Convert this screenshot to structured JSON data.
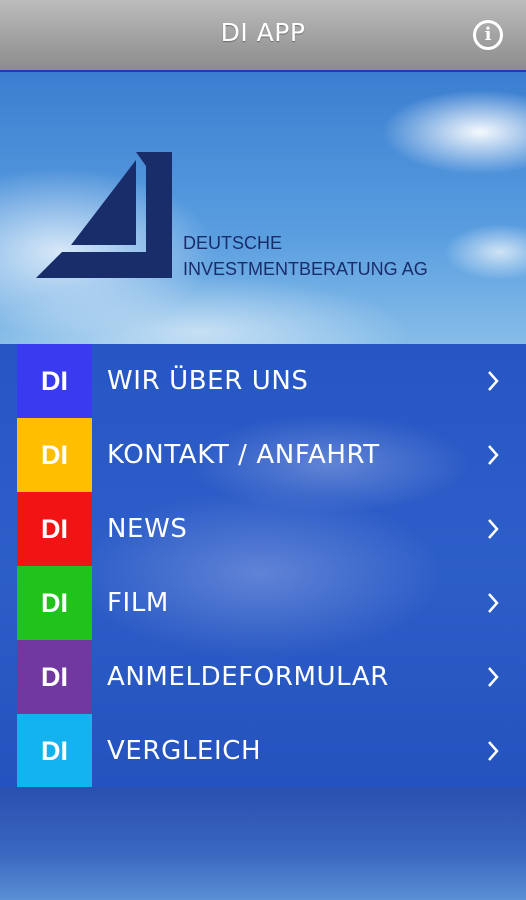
{
  "header": {
    "title": "DI APP",
    "info_icon": "info-circle-icon"
  },
  "logo": {
    "line1": "DEUTSCHE",
    "line2": "INVESTMENTBERATUNG AG",
    "color": "#1a2d6b"
  },
  "menu": {
    "items": [
      {
        "badge": "DI",
        "label": "WIR ÜBER UNS",
        "color": "#3a3af0"
      },
      {
        "badge": "DI",
        "label": "KONTAKT / ANFAHRT",
        "color": "#ffbf00"
      },
      {
        "badge": "DI",
        "label": "NEWS",
        "color": "#f21414"
      },
      {
        "badge": "DI",
        "label": "FILM",
        "color": "#22c21d"
      },
      {
        "badge": "DI",
        "label": "ANMELDEFORMULAR",
        "color": "#7038a0"
      },
      {
        "badge": "DI",
        "label": "VERGLEICH",
        "color": "#12b3ee"
      }
    ],
    "chevron_icon": "chevron-right-icon"
  }
}
